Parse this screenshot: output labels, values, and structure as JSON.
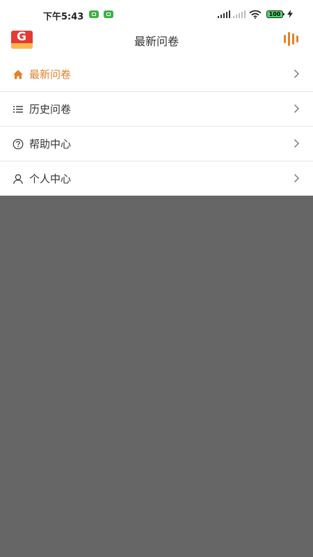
{
  "status_bar": {
    "time": "下午5:43",
    "battery": "100"
  },
  "header": {
    "title": "最新问卷",
    "logo_icon": "app-logo",
    "menu_icon": "menu-bars-icon"
  },
  "menu": {
    "items": [
      {
        "label": "最新问卷",
        "icon": "home-icon",
        "active": true
      },
      {
        "label": "历史问卷",
        "icon": "list-icon",
        "active": false
      },
      {
        "label": "帮助中心",
        "icon": "help-icon",
        "active": false
      },
      {
        "label": "个人中心",
        "icon": "user-icon",
        "active": false
      }
    ]
  },
  "colors": {
    "accent": "#e0822e",
    "overlay": "#666666"
  }
}
